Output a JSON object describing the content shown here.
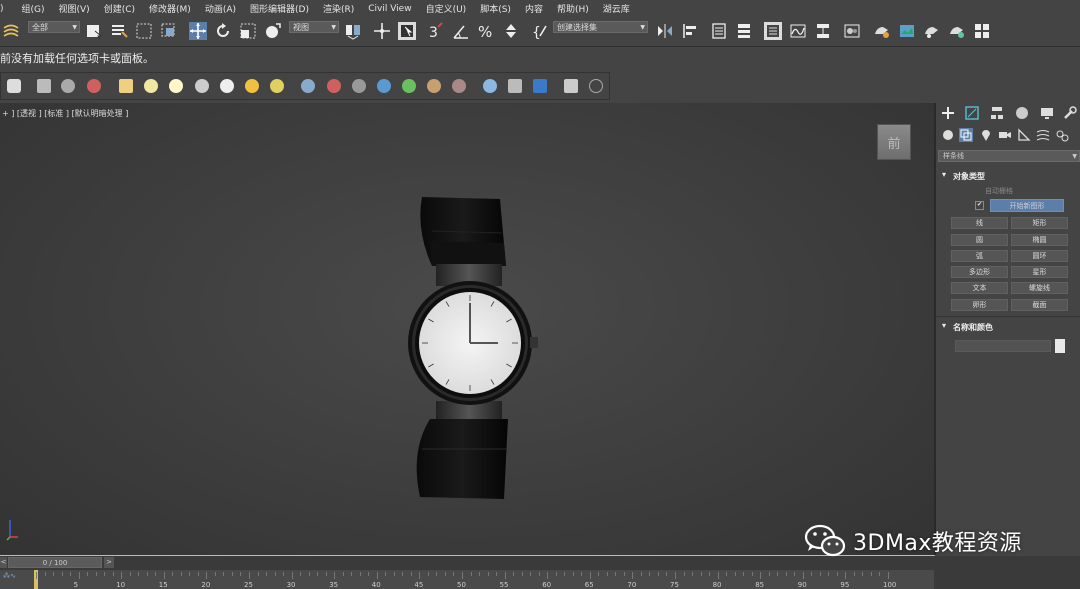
{
  "menu": {
    "items": [
      "组(G)",
      "视图(V)",
      "创建(C)",
      "修改器(M)",
      "动画(A)",
      "图形编辑器(D)",
      "渲染(R)",
      "Civil View",
      "自定义(U)",
      "脚本(S)",
      "内容",
      "帮助(H)",
      "湖云库"
    ]
  },
  "toolbar": {
    "filter_value": "全部",
    "ref_coord_value": "视图",
    "selection_set_value": "创建选择集"
  },
  "message": {
    "text": "前没有加载任何选项卡或面板。"
  },
  "viewport": {
    "label": "+ ] [透视 ] [标准 ] [默认明暗处理 ]",
    "viewcube_label": "前"
  },
  "command_panel": {
    "category_dropdown": "样条线",
    "object_type_header": "对象类型",
    "auto_grid_label": "自动栅格",
    "start_new_shape_label": "开始新图形",
    "buttons": [
      "线",
      "矩形",
      "圆",
      "椭圆",
      "弧",
      "圆环",
      "多边形",
      "星形",
      "文本",
      "螺旋线",
      "卵形",
      "截面"
    ],
    "name_color_header": "名称和颜色"
  },
  "timeline": {
    "frame_display": "0 / 100",
    "ticks": [
      "5",
      "10",
      "15",
      "20",
      "25",
      "30",
      "35",
      "40",
      "45",
      "50",
      "55",
      "60",
      "65",
      "70",
      "75",
      "80",
      "85",
      "90",
      "95",
      "100"
    ]
  },
  "watermark": {
    "text": "3DMax教程资源"
  }
}
